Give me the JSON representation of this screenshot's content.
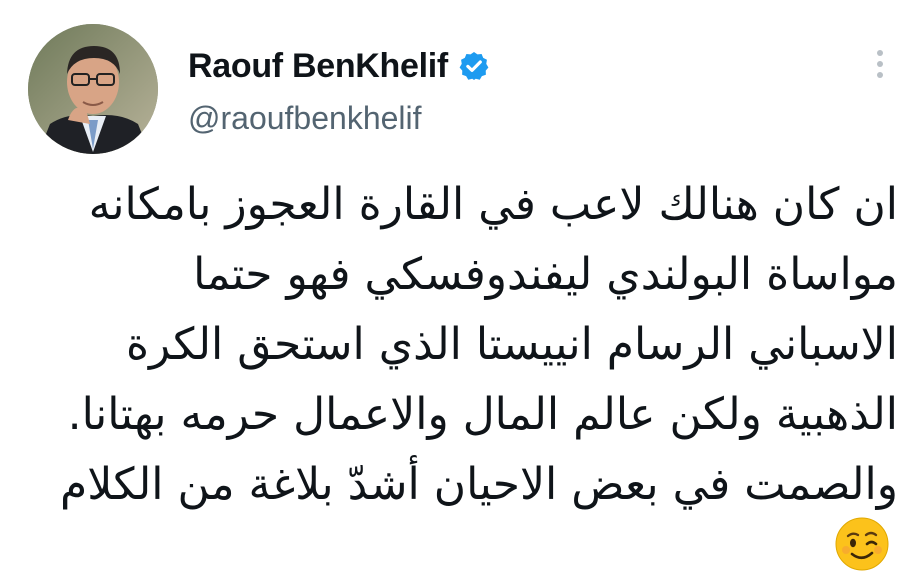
{
  "author": {
    "display_name": "Raouf BenKhelif",
    "handle": "@raoufbenkhelif",
    "verified": true
  },
  "icons": {
    "verified": "verified-badge-icon",
    "more": "more-options-icon",
    "emoji": "winking-face-emoji"
  },
  "tweet": {
    "lines": [
      "ان كان هنالك لاعب في القارة العجوز بامكانه",
      "مواساة البولندي ليفندوفسكي فهو حتما",
      "الاسباني الرسام انييستا الذي استحق الكرة",
      "الذهبية ولكن عالم المال والاعمال حرمه بهتانا.",
      "والصمت في بعض الاحيان أشدّ بلاغة من الكلام"
    ],
    "emoji": "😉"
  },
  "colors": {
    "verified_blue": "#1d9bf0",
    "text_primary": "#0f1419",
    "text_secondary": "#536471"
  }
}
